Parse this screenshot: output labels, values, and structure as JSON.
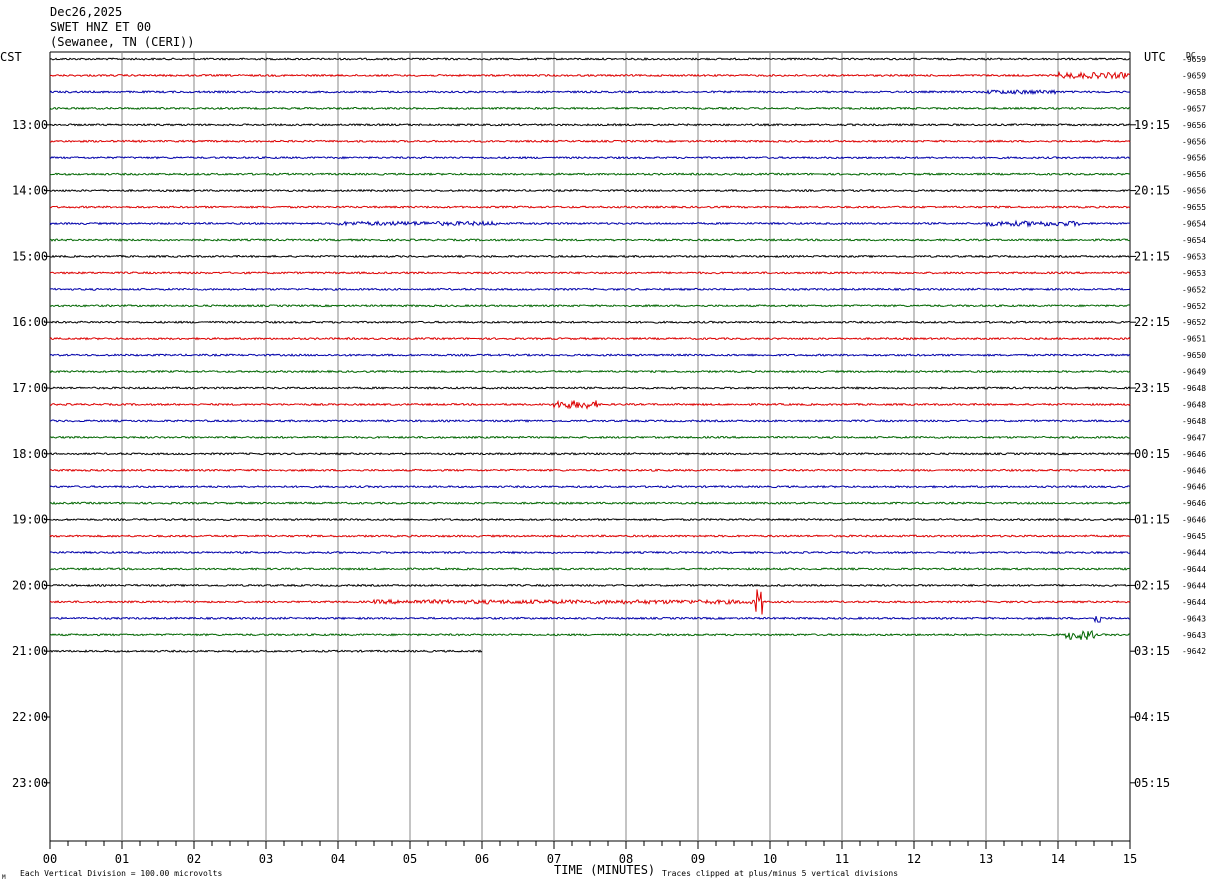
{
  "header": {
    "date": "Dec26,2025",
    "station": "SWET HNZ ET 00",
    "location": "(Sewanee, TN (CERI))"
  },
  "axes": {
    "left_timezone": "CST",
    "right_timezone": "UTC",
    "dc_label": "DC",
    "xlabel": "TIME (MINUTES)",
    "x_ticks": [
      "00",
      "01",
      "02",
      "03",
      "04",
      "05",
      "06",
      "07",
      "08",
      "09",
      "10",
      "11",
      "12",
      "13",
      "14",
      "15"
    ],
    "left_hours": [
      "13:00",
      "14:00",
      "15:00",
      "16:00",
      "17:00",
      "18:00",
      "19:00",
      "20:00",
      "21:00",
      "22:00",
      "23:00"
    ],
    "right_hours": [
      "19:15",
      "20:15",
      "21:15",
      "22:15",
      "23:15",
      "00:15",
      "01:15",
      "02:15",
      "03:15",
      "04:15",
      "05:15"
    ]
  },
  "footer": {
    "scale_note": "Each Vertical Division =  100.00 microvolts",
    "clip_note": "Traces clipped at plus/minus 5 vertical divisions",
    "corner_mark": "M"
  },
  "chart_data": {
    "type": "line",
    "description_kind": "helicorder",
    "minutes_per_line": 15,
    "lines_per_hour": 4,
    "colors": [
      "#000000",
      "#dd0000",
      "#0000aa",
      "#006600"
    ],
    "dc_offsets": [
      "-9659",
      "-9659",
      "-9658",
      "-9657",
      "-9656",
      "-9656",
      "-9656",
      "-9656",
      "-9656",
      "-9655",
      "-9654",
      "-9654",
      "-9653",
      "-9653",
      "-9652",
      "-9652",
      "-9652",
      "-9651",
      "-9650",
      "-9649",
      "-9648",
      "-9648",
      "-9648",
      "-9647",
      "-9646",
      "-9646",
      "-9646",
      "-9646",
      "-9646",
      "-9645",
      "-9644",
      "-9644",
      "-9644",
      "-9644",
      "-9643",
      "-9643",
      "-9642"
    ],
    "trace_count": 37,
    "last_trace_end_minute": 6.0,
    "events": [
      {
        "trace": 1,
        "start_min": 14.0,
        "end_min": 15.0,
        "amp": 3
      },
      {
        "trace": 2,
        "start_min": 13.0,
        "end_min": 14.0,
        "amp": 2
      },
      {
        "trace": 10,
        "start_min": 4.0,
        "end_min": 6.2,
        "amp": 2
      },
      {
        "trace": 10,
        "start_min": 13.0,
        "end_min": 14.3,
        "amp": 2.5
      },
      {
        "trace": 21,
        "start_min": 7.0,
        "end_min": 7.6,
        "amp": 4
      },
      {
        "trace": 33,
        "start_min": 4.5,
        "end_min": 9.9,
        "amp": 2
      },
      {
        "trace": 33,
        "start_min": 9.8,
        "end_min": 9.9,
        "amp": 14
      },
      {
        "trace": 34,
        "start_min": 14.5,
        "end_min": 14.6,
        "amp": 5
      },
      {
        "trace": 35,
        "start_min": 14.1,
        "end_min": 14.5,
        "amp": 5
      }
    ]
  }
}
